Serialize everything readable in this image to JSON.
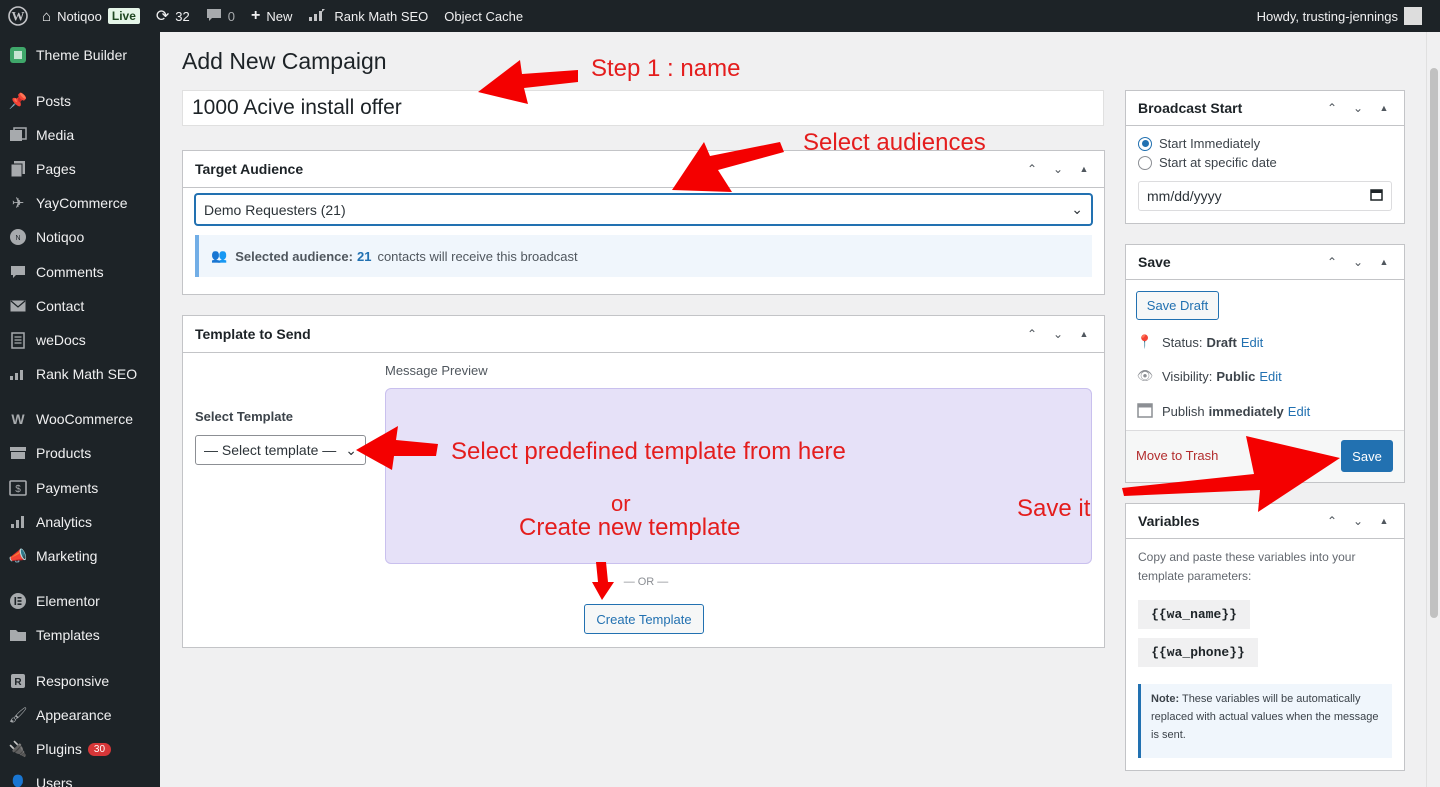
{
  "adminbar": {
    "site_name": "Notiqoo",
    "live_badge": "Live",
    "updates_count": "32",
    "comments_count": "0",
    "new_label": "New",
    "rank_math_label": "Rank Math SEO",
    "object_cache_label": "Object Cache",
    "howdy": "Howdy, trusting-jennings"
  },
  "sidebar": {
    "items": [
      {
        "label": "Theme Builder",
        "icon": "theme-builder-icon"
      },
      {
        "label": "Posts",
        "icon": "pin-icon"
      },
      {
        "label": "Media",
        "icon": "media-icon"
      },
      {
        "label": "Pages",
        "icon": "pages-icon"
      },
      {
        "label": "YayCommerce",
        "icon": "yaycommerce-icon"
      },
      {
        "label": "Notiqoo",
        "icon": "notiqoo-icon"
      },
      {
        "label": "Comments",
        "icon": "comment-icon"
      },
      {
        "label": "Contact",
        "icon": "mail-icon"
      },
      {
        "label": "weDocs",
        "icon": "docs-icon"
      },
      {
        "label": "Rank Math SEO",
        "icon": "rank-math-icon"
      },
      {
        "label": "WooCommerce",
        "icon": "woocommerce-icon"
      },
      {
        "label": "Products",
        "icon": "archive-icon"
      },
      {
        "label": "Payments",
        "icon": "payments-icon"
      },
      {
        "label": "Analytics",
        "icon": "chart-bar-icon"
      },
      {
        "label": "Marketing",
        "icon": "megaphone-icon"
      },
      {
        "label": "Elementor",
        "icon": "elementor-icon"
      },
      {
        "label": "Templates",
        "icon": "folder-icon"
      },
      {
        "label": "Responsive",
        "icon": "responsive-icon"
      },
      {
        "label": "Appearance",
        "icon": "brush-icon"
      },
      {
        "label": "Plugins",
        "icon": "plugin-icon"
      },
      {
        "label": "Users",
        "icon": "users-icon"
      }
    ],
    "plugins_badge": "30"
  },
  "main": {
    "page_title": "Add New Campaign",
    "campaign_name": "1000 Acive install offer",
    "target_audience": {
      "title": "Target Audience",
      "selected": "Demo Requesters (21)",
      "notice_label": "Selected audience:",
      "notice_count": "21",
      "notice_text": "contacts will receive this broadcast"
    },
    "template": {
      "title": "Template to Send",
      "preview_label": "Message Preview",
      "select_label": "Select Template",
      "select_placeholder": "— Select template —",
      "or_text": "— OR —",
      "create_button": "Create Template"
    }
  },
  "side": {
    "broadcast": {
      "title": "Broadcast Start",
      "option_immediate": "Start Immediately",
      "option_specific": "Start at specific date",
      "date_placeholder": "mm/dd/yyyy"
    },
    "save": {
      "title": "Save",
      "save_draft": "Save Draft",
      "status_label": "Status:",
      "status_value": "Draft",
      "visibility_label": "Visibility:",
      "visibility_value": "Public",
      "publish_label": "Publish",
      "publish_value": "immediately",
      "edit_label": "Edit",
      "trash_label": "Move to Trash",
      "save_button": "Save"
    },
    "variables": {
      "title": "Variables",
      "description": "Copy and paste these variables into your template parameters:",
      "var1": "{{wa_name}}",
      "var2": "{{wa_phone}}",
      "note_label": "Note:",
      "note_text": "These variables will be automatically replaced with actual values when the message is sent."
    }
  },
  "annotations": {
    "step1": "Step 1 : name",
    "audiences": "Select audiences",
    "predefined": "Select predefined template from here",
    "or": "or",
    "create_new": "Create new template",
    "save_it": "Save it",
    "color": "#e41d1d"
  }
}
